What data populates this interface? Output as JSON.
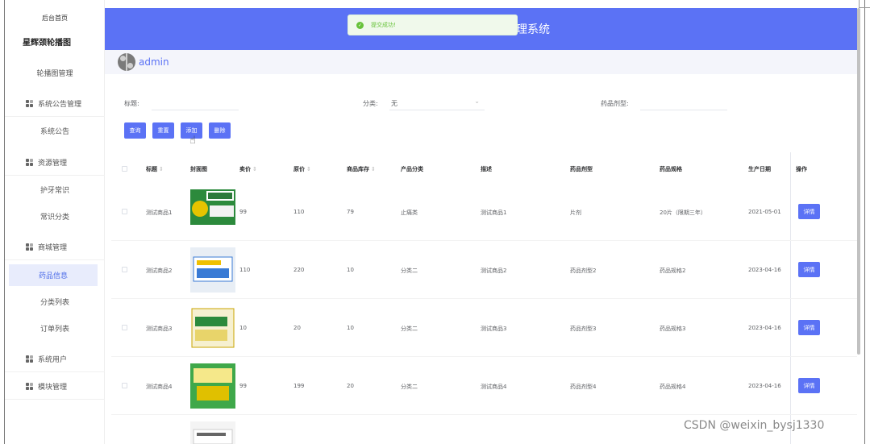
{
  "sidebar": {
    "home": "后台首页",
    "logo_text": "星辉颈轮播图",
    "items": [
      {
        "label": "轮播图管理",
        "type": "item"
      },
      {
        "label": "系统公告管理",
        "type": "group"
      },
      {
        "label": "系统公告",
        "type": "item"
      },
      {
        "label": "资源管理",
        "type": "group"
      },
      {
        "label": "护牙常识",
        "type": "item"
      },
      {
        "label": "常识分类",
        "type": "item"
      },
      {
        "label": "商城管理",
        "type": "group"
      },
      {
        "label": "药品信息",
        "type": "item",
        "active": true
      },
      {
        "label": "分类列表",
        "type": "item"
      },
      {
        "label": "订单列表",
        "type": "item"
      },
      {
        "label": "系统用户",
        "type": "group"
      },
      {
        "label": "模块管理",
        "type": "group"
      }
    ]
  },
  "header": {
    "title": "理系统",
    "user": "admin"
  },
  "toast": {
    "text": "提交成功!"
  },
  "filters": {
    "title_label": "标题:",
    "category_label": "分类:",
    "category_value": "无",
    "dosage_label": "药品剂型:"
  },
  "buttons": {
    "query": "查询",
    "reset": "重置",
    "add": "添加",
    "delete": "删除"
  },
  "table": {
    "columns": [
      "标题",
      "封面图",
      "卖价",
      "原价",
      "商品库存",
      "产品分类",
      "描述",
      "药品剂型",
      "药品规格",
      "生产日期",
      "操作"
    ],
    "rows": [
      {
        "title": "测试商品1",
        "price": "99",
        "orig": "110",
        "stock": "79",
        "category": "止痛类",
        "desc": "测试商品1",
        "dosage": "片剂",
        "spec": "20片（限期三年）",
        "date": "2021-05-01",
        "action": "详情"
      },
      {
        "title": "测试商品2",
        "price": "110",
        "orig": "220",
        "stock": "10",
        "category": "分类二",
        "desc": "测试商品2",
        "dosage": "药品剂型2",
        "spec": "药品规格2",
        "date": "2023-04-16",
        "action": "详情"
      },
      {
        "title": "测试商品3",
        "price": "10",
        "orig": "20",
        "stock": "10",
        "category": "分类二",
        "desc": "测试商品3",
        "dosage": "药品剂型3",
        "spec": "药品规格3",
        "date": "2023-04-16",
        "action": "详情"
      },
      {
        "title": "测试商品4",
        "price": "99",
        "orig": "199",
        "stock": "20",
        "category": "分类二",
        "desc": "测试商品4",
        "dosage": "药品剂型4",
        "spec": "药品规格4",
        "date": "2023-04-16",
        "action": "详情"
      }
    ]
  },
  "colors": {
    "primary": "#5b72f5",
    "success": "#67c23a"
  },
  "watermark": "CSDN @weixin_bysj1330"
}
